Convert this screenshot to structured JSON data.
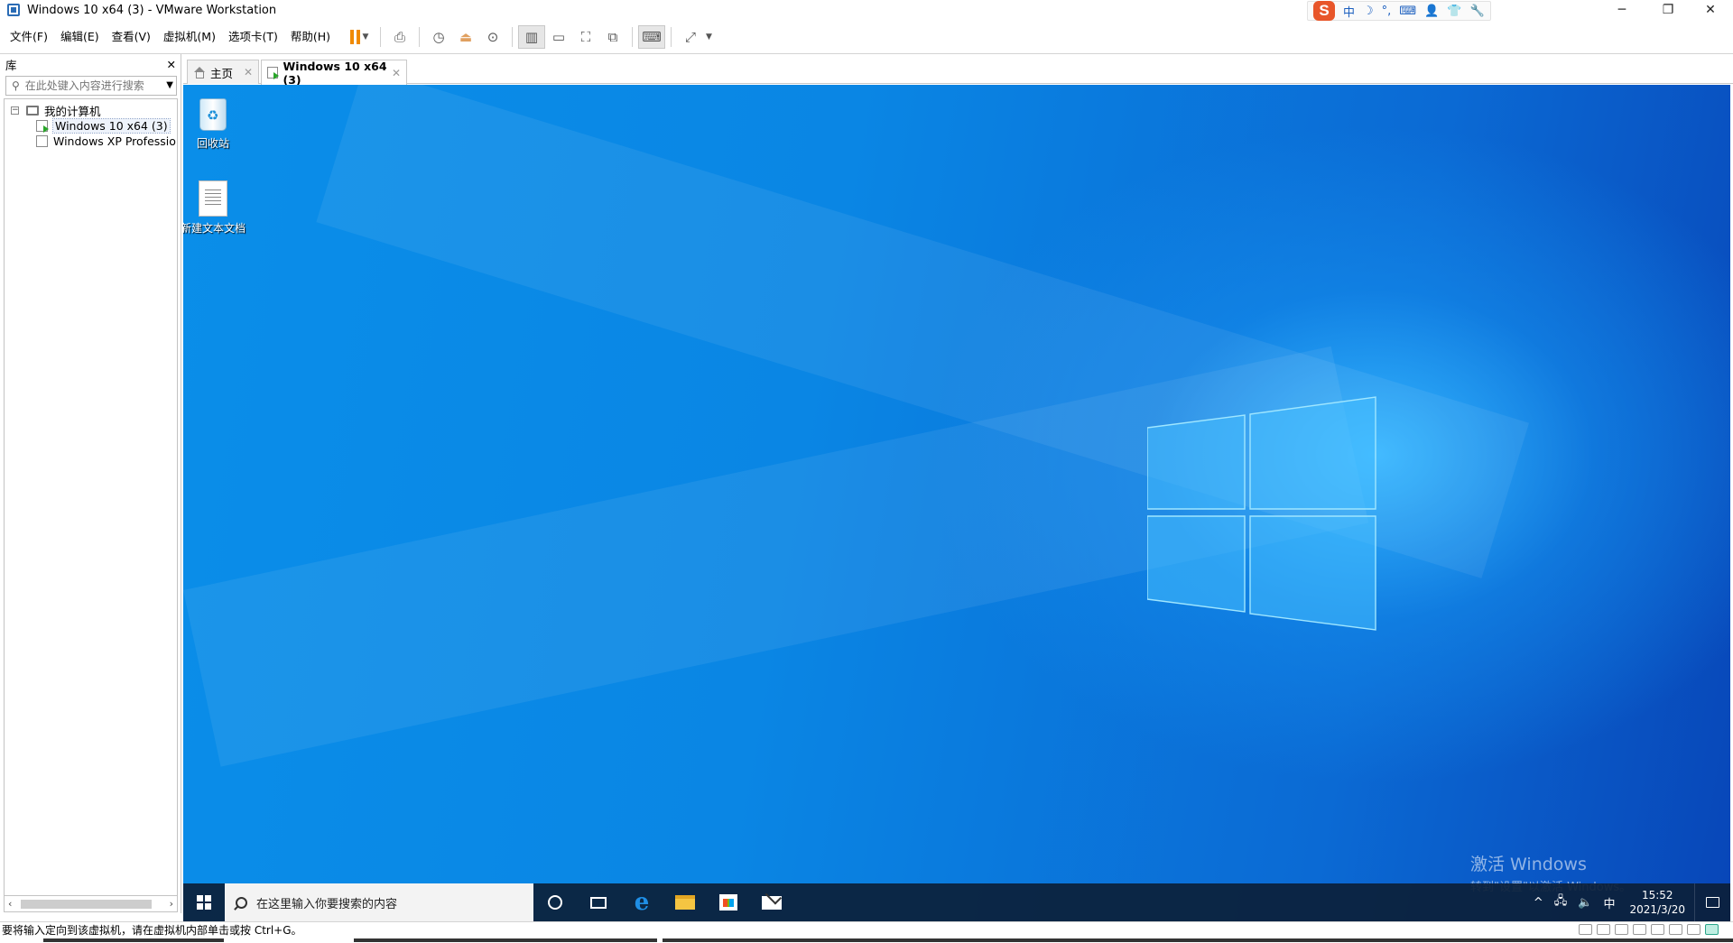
{
  "window": {
    "title": "Windows 10 x64 (3) - VMware Workstation",
    "minimize": "─",
    "restore": "❐",
    "close": "✕"
  },
  "ime": {
    "logo": "S",
    "items": [
      "中",
      "☽",
      "°,",
      "⌨",
      "👤",
      "👕",
      "🔧"
    ]
  },
  "menu": [
    "文件(F)",
    "编辑(E)",
    "查看(V)",
    "虚拟机(M)",
    "选项卡(T)",
    "帮助(H)"
  ],
  "library": {
    "title": "库",
    "close": "✕",
    "search_placeholder": "在此处键入内容进行搜索",
    "tree": {
      "root": "我的计算机",
      "items": [
        "Windows 10 x64 (3)",
        "Windows XP Professional"
      ]
    }
  },
  "tabs": [
    {
      "label": "主页",
      "close": "✕"
    },
    {
      "label": "Windows 10 x64 (3)",
      "close": "✕"
    }
  ],
  "desktop": {
    "icons": [
      {
        "label": "回收站"
      },
      {
        "label": "新建文本文档"
      }
    ],
    "activation": {
      "line1": "激活 Windows",
      "line2": "转到\"设置\"以激活 Windows。"
    }
  },
  "taskbar": {
    "search_placeholder": "在这里输入你要搜索的内容",
    "tray": {
      "chevron": "^",
      "network": "🖧",
      "volume": "🔈",
      "ime": "中",
      "time": "15:52",
      "date": "2021/3/20"
    }
  },
  "statusbar": {
    "text": "要将输入定向到该虚拟机，请在虚拟机内部单击或按 Ctrl+G。"
  },
  "colors": {
    "desktop_blue": "#0a86e4",
    "pause_orange": "#f08a00",
    "taskbar": "#0c2038"
  }
}
